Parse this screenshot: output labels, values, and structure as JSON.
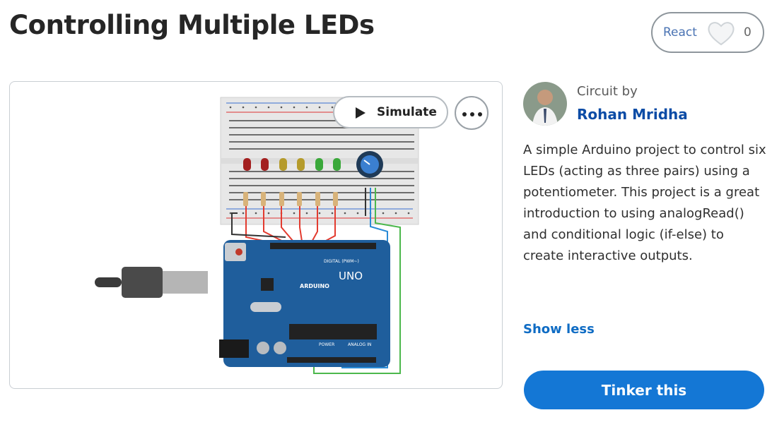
{
  "page": {
    "title": "Controlling Multiple LEDs"
  },
  "react": {
    "label": "React",
    "count": "0",
    "icon": "heart-icon"
  },
  "preview": {
    "simulate_label": "Simulate",
    "simulate_icon": "play-icon",
    "more_icon": "more-icon",
    "board": {
      "brand": "ARDUINO",
      "model": "UNO",
      "digital_label": "DIGITAL (PWM~)",
      "power_label": "POWER",
      "analog_label": "ANALOG IN"
    },
    "led_colors": [
      "#a31f1f",
      "#a31f1f",
      "#b59b2b",
      "#b59b2b",
      "#3aa83a",
      "#3aa83a"
    ]
  },
  "author": {
    "caption": "Circuit by",
    "name": "Rohan Mridha"
  },
  "description": "A simple Arduino project to control six LEDs (acting as three pairs) using a potentiometer. This project is a great introduction to using analogRead() and conditional logic (if-else) to create interactive outputs.",
  "actions": {
    "show_less": "Show less",
    "tinker": "Tinker this"
  },
  "colors": {
    "accent": "#1477d5",
    "link": "#0c4ca6",
    "board": "#1f5e9c",
    "wire_red": "#e33b2f",
    "wire_blue": "#2a8bd6",
    "wire_green": "#4cb84c"
  }
}
